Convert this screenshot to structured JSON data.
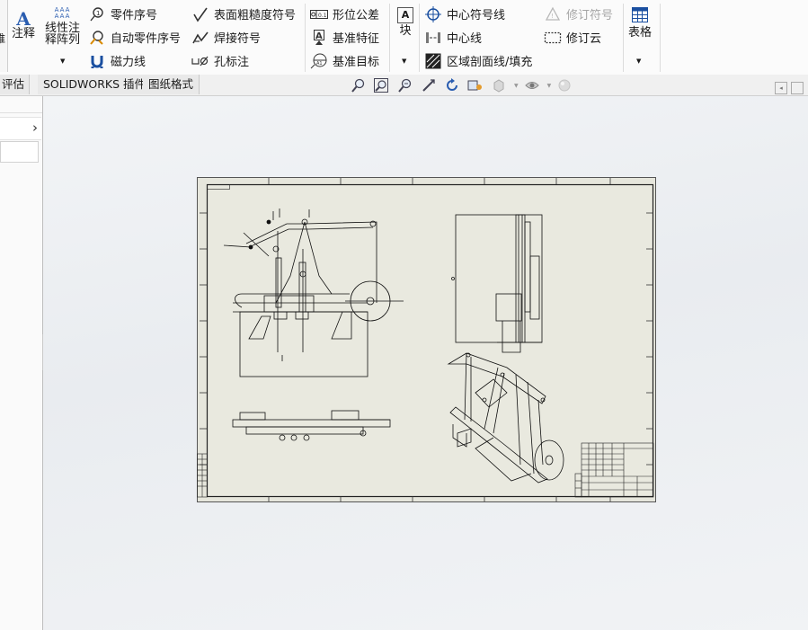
{
  "ribbon": {
    "partial_left_label": "维",
    "annotation": "注释",
    "linear_note_pattern": "线性注\n释阵列",
    "balloon": "零件序号",
    "auto_balloon": "自动零件序号",
    "magnetic_line": "磁力线",
    "surface_finish": "表面粗糙度符号",
    "weld_symbol": "焊接符号",
    "hole_callout": "孔标注",
    "geometric_tolerance": "形位公差",
    "datum_feature": "基准特征",
    "datum_target": "基准目标",
    "block": "块",
    "center_mark": "中心符号线",
    "centerline": "中心线",
    "area_hatch": "区域剖面线/填充",
    "revision_symbol": "修订符号",
    "revision_cloud": "修订云",
    "table": "表格"
  },
  "tabs": {
    "evaluate": "评估",
    "addins": "SOLIDWORKS 插件",
    "sheet_format": "图纸格式"
  }
}
